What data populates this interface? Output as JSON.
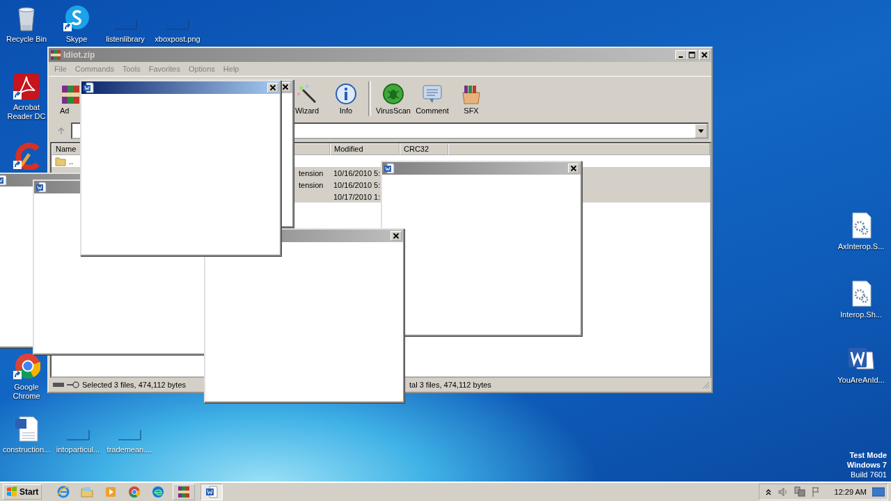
{
  "desktop_icons": [
    {
      "label": "Recycle Bin",
      "kind": "recycle",
      "shortcut": false
    },
    {
      "label": "Skype",
      "kind": "skype",
      "shortcut": true
    },
    {
      "label": "listenlibrary",
      "kind": "blank",
      "shortcut": false
    },
    {
      "label": "xboxpost.png",
      "kind": "blank",
      "shortcut": false
    },
    {
      "label": "Acrobat Reader DC",
      "kind": "acrobat",
      "shortcut": true
    },
    {
      "kind": "ccleaner",
      "shortcut": true
    },
    {
      "label": "Google Chrome",
      "kind": "chrome",
      "shortcut": true
    },
    {
      "label": "construction...",
      "kind": "worddoc",
      "shortcut": false
    },
    {
      "label": "intoparticul...",
      "kind": "blank",
      "shortcut": false
    },
    {
      "label": "trademean....",
      "kind": "blank",
      "shortcut": false
    },
    {
      "label": "AxInterop.S...",
      "kind": "config",
      "shortcut": false
    },
    {
      "label": "Interop.Sh...",
      "kind": "config",
      "shortcut": false
    },
    {
      "label": "YouAreAnId...",
      "kind": "word",
      "shortcut": false
    }
  ],
  "archive_window": {
    "title": "Idiot.zip",
    "active": false,
    "menu": [
      "File",
      "Commands",
      "Tools",
      "Favorites",
      "Options",
      "Help"
    ],
    "toolbar": [
      {
        "label": "Ad",
        "kind": "add"
      },
      {
        "label": "Wizard",
        "kind": "wizard"
      },
      {
        "label": "Info",
        "kind": "info"
      },
      {
        "label": "VirusScan",
        "kind": "virus"
      },
      {
        "label": "Comment",
        "kind": "comment"
      },
      {
        "label": "SFX",
        "kind": "sfx"
      }
    ],
    "columns": [
      "Name",
      "Modified",
      "CRC32"
    ],
    "rows": [
      {
        "kind": "folder",
        "name": "..",
        "selected": false
      },
      {
        "kind": "file",
        "type": "tension",
        "modified": "10/16/2010 5:",
        "selected": true
      },
      {
        "kind": "file",
        "type": "tension",
        "modified": "10/16/2010 5:",
        "selected": true
      },
      {
        "kind": "file",
        "modified": "10/17/2010 1:",
        "selected": true
      }
    ],
    "status_left": "Selected 3 files, 474,112 bytes",
    "status_right": "tal 3 files, 474,112 bytes"
  },
  "popups": [
    {
      "active": false,
      "icon": false,
      "close": true
    },
    {
      "active": false,
      "icon": true,
      "close": false
    },
    {
      "active": false,
      "icon": true,
      "close": false
    },
    {
      "active": false,
      "icon": true,
      "close": true
    },
    {
      "active": false,
      "icon": false,
      "close": true
    },
    {
      "active": true,
      "icon": true,
      "close": true
    }
  ],
  "watermark_text": [
    "Test Mode",
    "Windows 7",
    "Build 7601"
  ],
  "taskbar": {
    "start": "Start",
    "apps": [
      {
        "kind": "ie",
        "running": false,
        "selected": false
      },
      {
        "kind": "explorer",
        "running": false,
        "selected": false
      },
      {
        "kind": "media",
        "running": false,
        "selected": false
      },
      {
        "kind": "chrome",
        "running": false,
        "selected": false
      },
      {
        "kind": "edge",
        "running": false,
        "selected": false
      },
      {
        "kind": "winrar",
        "running": true,
        "selected": false
      },
      {
        "kind": "word",
        "running": true,
        "selected": true
      }
    ],
    "clock": "12:29 AM"
  }
}
